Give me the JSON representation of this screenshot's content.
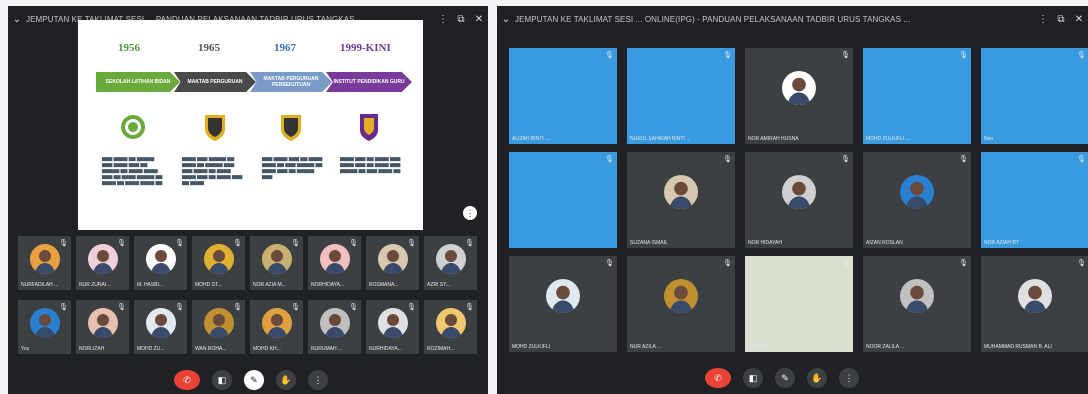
{
  "window1": {
    "title": "JEMPUTAN KE TAKLIMAT SESI ... PANDUAN PELAKSANAAN TADBIR URUS TANGKAS ...",
    "slide": {
      "years": [
        "1956",
        "1965",
        "1967",
        "1999-KINI"
      ],
      "year_colors": [
        "#4a9a3a",
        "#555555",
        "#3a6ab0",
        "#6a3a9a"
      ],
      "stages": [
        "SEKOLAH LATIHAN BIDAN",
        "MAKTAB PERGURUAN",
        "MAKTAB PERGURUAN PERSEKUTUAN",
        "INSTITUT PENDIDIKAN GURU"
      ],
      "stage_colors": [
        "#6aaa3a",
        "#4a4a4a",
        "#7a9ac8",
        "#7a3a9a"
      ]
    },
    "participants_row1": [
      "NURFADILAH ...",
      "NUR ZURAI...",
      "M. HASBI...",
      "MOHD ST...",
      "NOR AZIA M...",
      "NORHIDAYA...",
      "ROSMANA...",
      "AZRI SY..."
    ],
    "participants_row2": [
      "You",
      "NORLIZAH",
      "MOHD ZU...",
      "WAN ROHA...",
      "MOHD KH...",
      "NURUMAH ...",
      "NURHIDAYA...",
      "ROZIMAH..."
    ],
    "more_icon": "⋮"
  },
  "window2": {
    "title": "JEMPUTAN KE TAKLIMAT SESI ... ONLINE(IPG) - PANDUAN PELAKSANAAN TADBIR URUS TANGKAS ...",
    "tiles": [
      {
        "name": "ALIZAH BINTI ...",
        "type": "video"
      },
      {
        "name": "NURUL SAHIRAH BINTI ...",
        "type": "video"
      },
      {
        "name": "NOR AMIRAH HUSNA",
        "type": "avatar"
      },
      {
        "name": "MOHD ZULKIFLI ...",
        "type": "video"
      },
      {
        "name": "Neo",
        "type": "video"
      },
      {
        "name": "",
        "type": "video"
      },
      {
        "name": "SUZANA ISMAIL",
        "type": "avatar"
      },
      {
        "name": "NOR HIDAYAH",
        "type": "avatar"
      },
      {
        "name": "AIZAN ROSLAN",
        "type": "avatar"
      },
      {
        "name": "NOR AZIAH BT",
        "type": "video"
      },
      {
        "name": "MOHD ZULKIFLI",
        "type": "avatar"
      },
      {
        "name": "NUR AZILA ...",
        "type": "avatar"
      },
      {
        "name": "ZAKARIA ...",
        "type": "video"
      },
      {
        "name": "NOOR ZALILA ...",
        "type": "avatar"
      },
      {
        "name": "MUHAMMAD RUSMAN B. ALI",
        "type": "avatar"
      }
    ]
  },
  "colors": {
    "meet_bg": "#202124",
    "tile_bg": "#3c4043",
    "end_call": "#ea4335"
  }
}
